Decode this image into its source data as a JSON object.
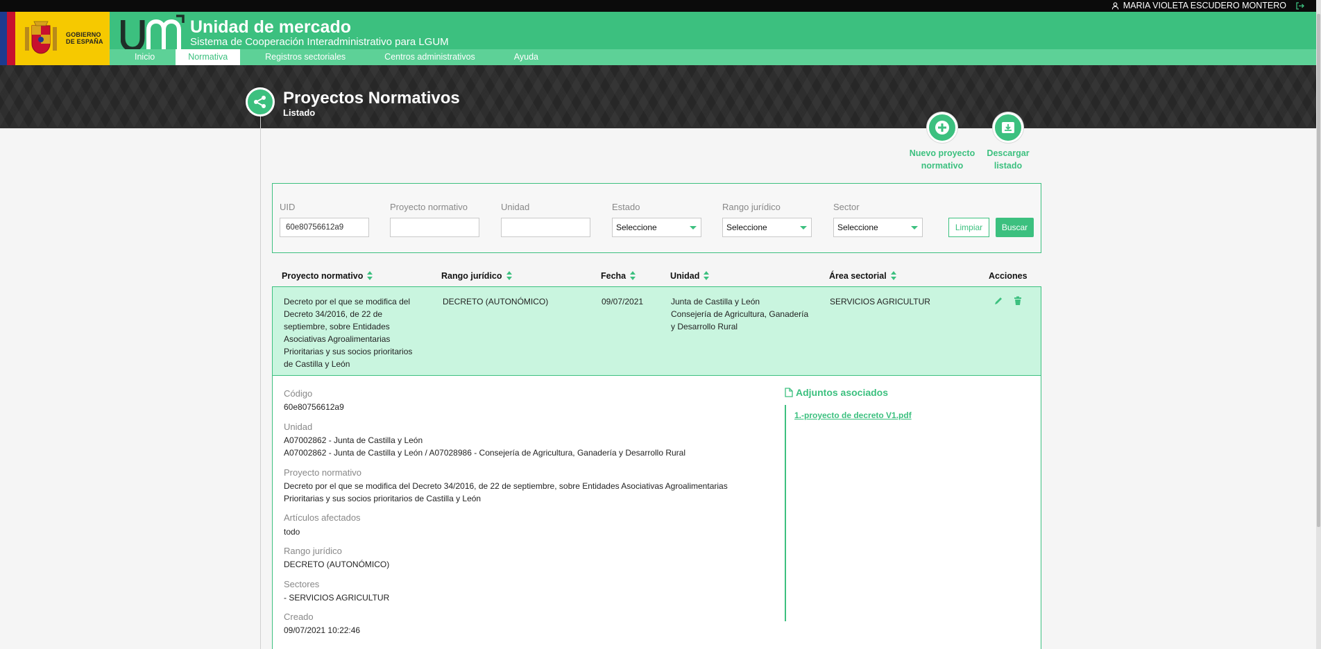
{
  "user": {
    "name": "MARIA VIOLETA ESCUDERO MONTERO"
  },
  "header": {
    "gov_line1": "GOBIERNO",
    "gov_line2": "DE ESPAÑA",
    "title": "Unidad de mercado",
    "subtitle": "Sistema de Cooperación Interadministrativo para LGUM"
  },
  "nav": {
    "items": [
      "Inicio",
      "Normativa",
      "Registros sectoriales",
      "Centros administrativos",
      "Ayuda"
    ],
    "active": "Normativa"
  },
  "page": {
    "title": "Proyectos Normativos",
    "subtitle": "Listado"
  },
  "actions": {
    "new_line1": "Nuevo proyecto",
    "new_line2": "normativo",
    "download_line1": "Descargar",
    "download_line2": "listado"
  },
  "filters": {
    "uid": {
      "label": "UID",
      "value": "60e80756612a9"
    },
    "proyecto": {
      "label": "Proyecto normativo",
      "value": ""
    },
    "unidad": {
      "label": "Unidad",
      "value": ""
    },
    "estado": {
      "label": "Estado",
      "value": "Seleccione"
    },
    "rango": {
      "label": "Rango jurídico",
      "value": "Seleccione"
    },
    "sector": {
      "label": "Sector",
      "value": "Seleccione"
    },
    "clear": "Limpiar",
    "search": "Buscar"
  },
  "table": {
    "headers": [
      "Proyecto normativo",
      "Rango jurídico",
      "Fecha",
      "Unidad",
      "Área sectorial",
      "Acciones"
    ],
    "row": {
      "proyecto": [
        "Decreto por el que se modifica del",
        "Decreto 34/2016, de 22 de",
        "septiembre, sobre Entidades",
        "Asociativas Agroalimentarias",
        "Prioritarias y sus socios prioritarios",
        "de Castilla y León"
      ],
      "rango": "DECRETO (AUTONÓMICO)",
      "fecha": "09/07/2021",
      "unidad": [
        "Junta de Castilla y León",
        "Consejería de Agricultura, Ganadería",
        "y Desarrollo Rural"
      ],
      "area": "SERVICIOS AGRICULTUR"
    }
  },
  "detail": {
    "codigo_label": "Código",
    "codigo": "60e80756612a9",
    "unidad_label": "Unidad",
    "unidad_1": "A07002862 - Junta de Castilla y León",
    "unidad_2": "A07002862 - Junta de Castilla y León / A07028986 - Consejería de Agricultura, Ganadería y Desarrollo Rural",
    "proyecto_label": "Proyecto normativo",
    "proyecto_1": "Decreto por el que se modifica del Decreto 34/2016, de 22 de septiembre, sobre Entidades Asociativas Agroalimentarias",
    "proyecto_2": "Prioritarias y sus socios prioritarios de Castilla y León",
    "articulos_label": "Artículos afectados",
    "articulos": "todo",
    "rango_label": "Rango jurídico",
    "rango": "DECRETO (AUTONÓMICO)",
    "sectores_label": "Sectores",
    "sectores": "- SERVICIOS AGRICULTUR",
    "creado_label": "Creado",
    "creado": "09/07/2021 10:22:46",
    "adjuntos_title": "Adjuntos asociados",
    "adjunto_1": "1.-proyecto de decreto V1.pdf"
  },
  "colors": {
    "accent": "#3cc07f",
    "row_highlight": "#c9f5df",
    "band": "#2e2e2e"
  }
}
